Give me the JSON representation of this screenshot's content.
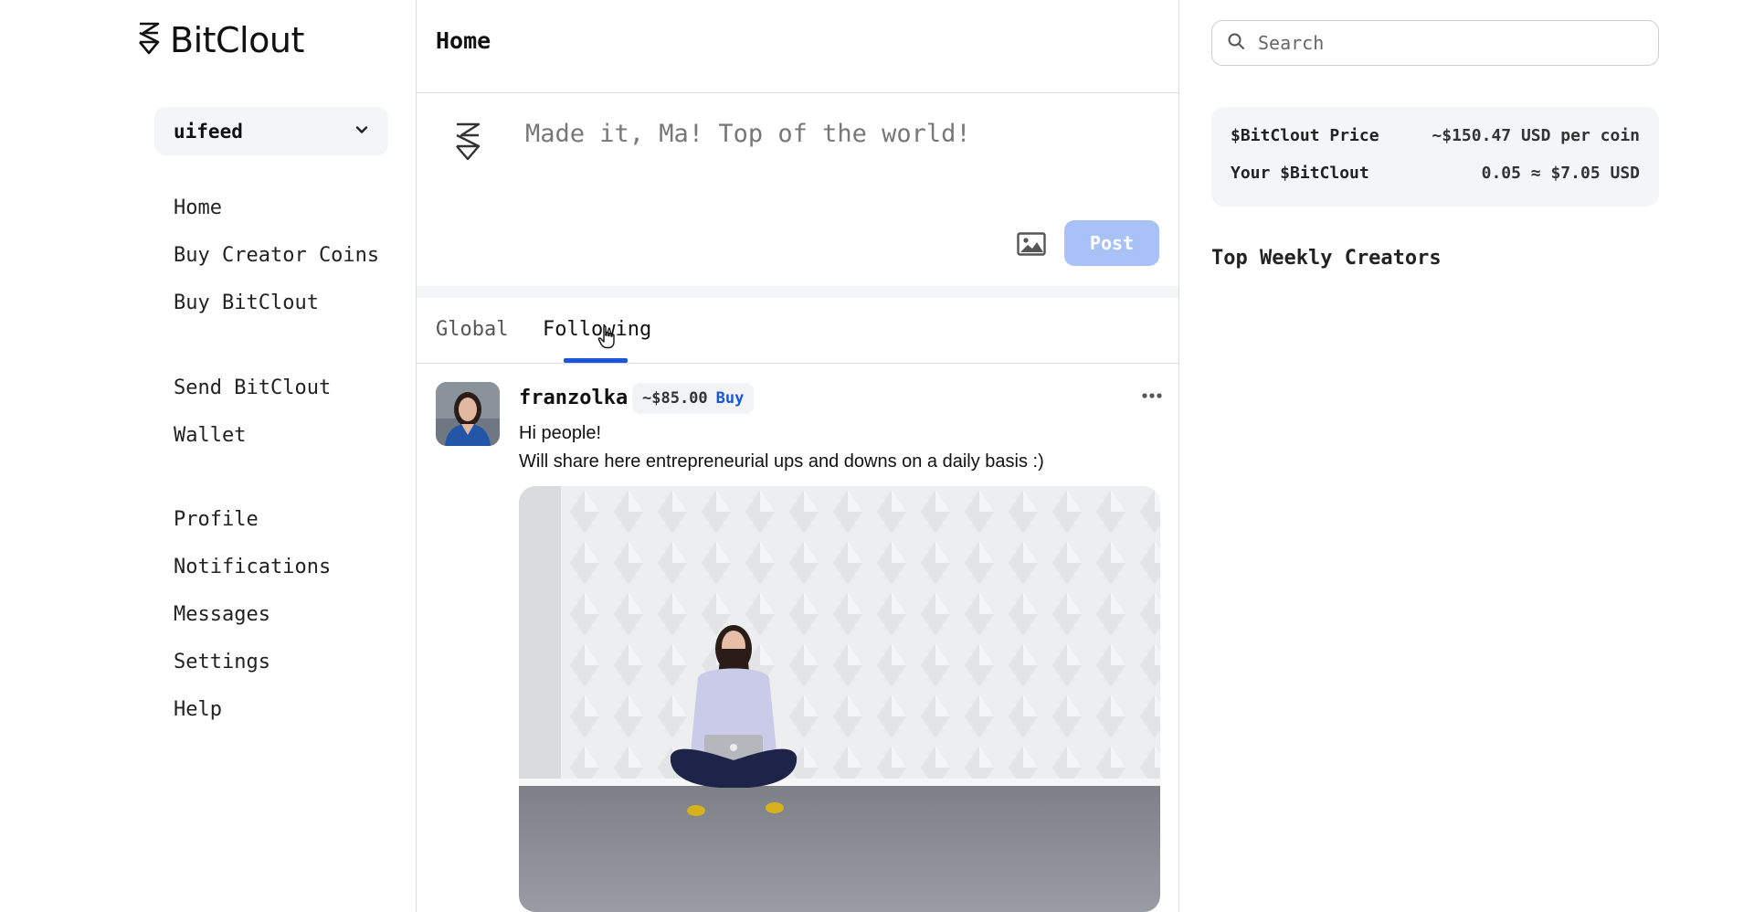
{
  "app": {
    "name": "BitClout"
  },
  "account": {
    "username": "uifeed"
  },
  "nav": {
    "group1": [
      "Home",
      "Buy Creator Coins",
      "Buy BitClout"
    ],
    "group2": [
      "Send BitClout",
      "Wallet"
    ],
    "group3": [
      "Profile",
      "Notifications",
      "Messages",
      "Settings",
      "Help"
    ]
  },
  "feed": {
    "title": "Home",
    "composer": {
      "placeholder": "Made it, Ma! Top of the world!",
      "post_label": "Post"
    },
    "tabs": {
      "global": "Global",
      "following": "Following",
      "active": "Following"
    }
  },
  "post": {
    "username": "franzolka",
    "coin_price": "~$85.00",
    "buy_label": "Buy",
    "body_line1": "Hi people!",
    "body_line2": "Will share here entrepreneurial ups and downs on a daily basis :)"
  },
  "sidebar_right": {
    "search_placeholder": "Search",
    "price_label": "$BitClout Price",
    "price_value": "~$150.47 USD per coin",
    "balance_label": "Your $BitClout",
    "balance_value": "0.05 ≈ $7.05 USD",
    "top_creators_title": "Top Weekly Creators"
  },
  "colors": {
    "accent": "#1a56db",
    "post_button": "#a8c2f7",
    "card_bg": "#f4f5f6"
  },
  "icons": [
    "bitclout-logo-icon",
    "chevron-down-icon",
    "image-icon",
    "more-dots-icon",
    "search-icon",
    "hand-cursor-icon"
  ]
}
